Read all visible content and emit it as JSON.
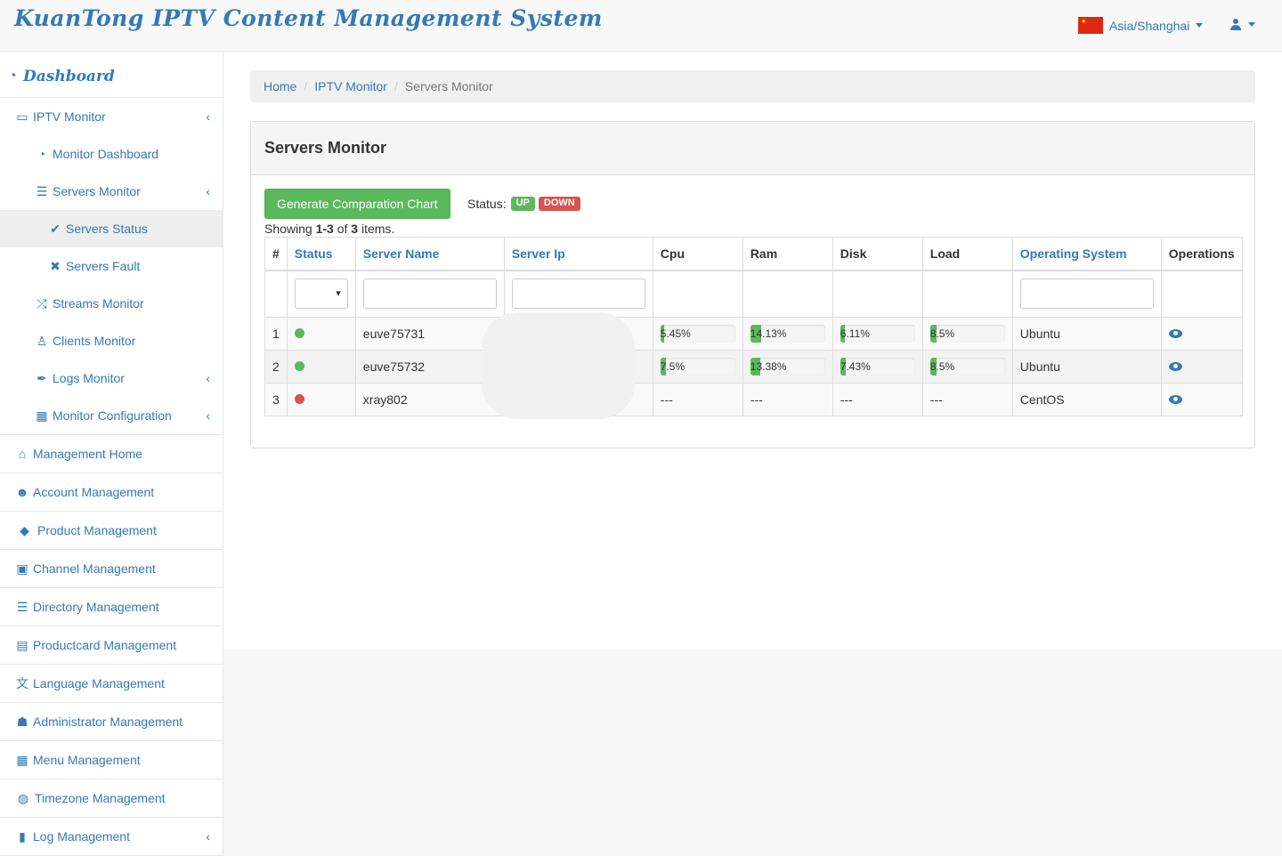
{
  "header": {
    "brand": "KuanTong IPTV Content Management System",
    "timezone": "Asia/Shanghai",
    "flag_icon": "china-flag-icon",
    "user_icon": "user-icon"
  },
  "sidebar": {
    "dashboard": "Dashboard",
    "iptv_monitor": "IPTV Monitor",
    "monitor_dashboard": "Monitor Dashboard",
    "servers_monitor": "Servers Monitor",
    "servers_status": "Servers Status",
    "servers_fault": "Servers Fault",
    "streams_monitor": "Streams Monitor",
    "clients_monitor": "Clients Monitor",
    "logs_monitor": "Logs Monitor",
    "monitor_configuration": "Monitor Configuration",
    "management_home": "Management Home",
    "account_management": "Account Management",
    "product_management": "Product Management",
    "channel_management": "Channel Management",
    "directory_management": "Directory Management",
    "productcard_management": "Productcard Management",
    "language_management": "Language Management",
    "administrator_management": "Administrator Management",
    "menu_management": "Menu Management",
    "timezone_management": "Timezone Management",
    "log_management": "Log Management"
  },
  "breadcrumb": {
    "home": "Home",
    "iptv_monitor": "IPTV Monitor",
    "current": "Servers Monitor"
  },
  "panel": {
    "title": "Servers Monitor",
    "generate_button": "Generate Comparation Chart",
    "status_label": "Status:",
    "status_up": "UP",
    "status_down": "DOWN",
    "summary_prefix": "Showing ",
    "summary_range": "1-3",
    "summary_of": " of ",
    "summary_total": "3",
    "summary_suffix": " items."
  },
  "table": {
    "columns": [
      "#",
      "Status",
      "Server Name",
      "Server Ip",
      "Cpu",
      "Ram",
      "Disk",
      "Load",
      "Operating System",
      "Operations"
    ],
    "rows": [
      {
        "num": "1",
        "status": "up",
        "name": "euve75731",
        "ip": "",
        "cpu": "5.45%",
        "cpu_value": 5.45,
        "ram": "14.13%",
        "ram_value": 14.13,
        "disk": "6.11%",
        "disk_value": 6.11,
        "load": "8.5%",
        "load_value": 8.5,
        "os": "Ubuntu",
        "action_icon": "eye-icon"
      },
      {
        "num": "2",
        "status": "up",
        "name": "euve75732",
        "ip": "",
        "cpu": "7.5%",
        "cpu_value": 7.5,
        "ram": "13.38%",
        "ram_value": 13.38,
        "disk": "7.43%",
        "disk_value": 7.43,
        "load": "8.5%",
        "load_value": 8.5,
        "os": "Ubuntu",
        "action_icon": "eye-icon"
      },
      {
        "num": "3",
        "status": "down",
        "name": "xray802",
        "ip": "",
        "cpu": "---",
        "ram": "---",
        "disk": "---",
        "load": "---",
        "os": "CentOS",
        "action_icon": "eye-icon"
      }
    ]
  },
  "colors": {
    "primary": "#337ab7",
    "success": "#5cb85c",
    "danger": "#d9534f"
  }
}
